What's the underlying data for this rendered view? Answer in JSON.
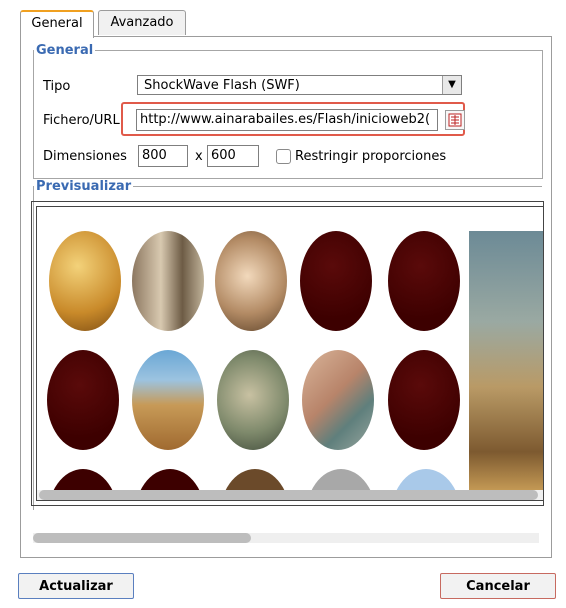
{
  "tabs": [
    {
      "label": "General",
      "active": true
    },
    {
      "label": "Avanzado",
      "active": false
    }
  ],
  "general": {
    "legend": "General",
    "tipo_label": "Tipo",
    "tipo_value": "ShockWave Flash (SWF)",
    "fichero_label": "Fichero/URL",
    "fichero_value": "http://www.ainarabailes.es/Flash/inicioweb2(",
    "dimensiones_label": "Dimensiones",
    "width_value": "800",
    "x_label": "x",
    "height_value": "600",
    "restringir_label": "Restringir proporciones",
    "restringir_checked": false
  },
  "preview": {
    "legend": "Previsualizar"
  },
  "buttons": {
    "actualizar": "Actualizar",
    "cancelar": "Cancelar"
  },
  "colors": {
    "legend": "#3a6ab2",
    "highlight": "#e05a4a",
    "dark_oval": "#3d0000"
  }
}
